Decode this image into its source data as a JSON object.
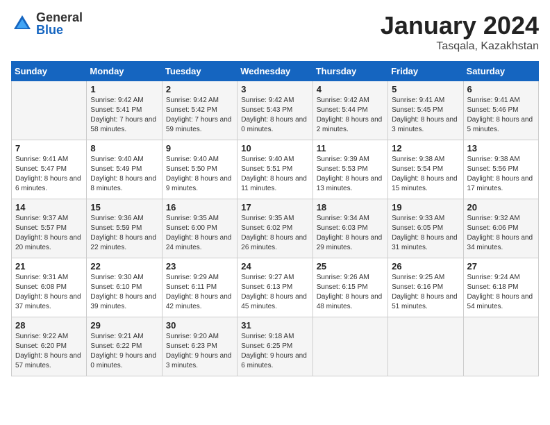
{
  "header": {
    "logo_general": "General",
    "logo_blue": "Blue",
    "title": "January 2024",
    "subtitle": "Tasqala, Kazakhstan"
  },
  "days_of_week": [
    "Sunday",
    "Monday",
    "Tuesday",
    "Wednesday",
    "Thursday",
    "Friday",
    "Saturday"
  ],
  "weeks": [
    [
      {
        "day": "",
        "info": ""
      },
      {
        "day": "1",
        "info": "Sunrise: 9:42 AM\nSunset: 5:41 PM\nDaylight: 7 hours\nand 58 minutes."
      },
      {
        "day": "2",
        "info": "Sunrise: 9:42 AM\nSunset: 5:42 PM\nDaylight: 7 hours\nand 59 minutes."
      },
      {
        "day": "3",
        "info": "Sunrise: 9:42 AM\nSunset: 5:43 PM\nDaylight: 8 hours\nand 0 minutes."
      },
      {
        "day": "4",
        "info": "Sunrise: 9:42 AM\nSunset: 5:44 PM\nDaylight: 8 hours\nand 2 minutes."
      },
      {
        "day": "5",
        "info": "Sunrise: 9:41 AM\nSunset: 5:45 PM\nDaylight: 8 hours\nand 3 minutes."
      },
      {
        "day": "6",
        "info": "Sunrise: 9:41 AM\nSunset: 5:46 PM\nDaylight: 8 hours\nand 5 minutes."
      }
    ],
    [
      {
        "day": "7",
        "info": "Sunrise: 9:41 AM\nSunset: 5:47 PM\nDaylight: 8 hours\nand 6 minutes."
      },
      {
        "day": "8",
        "info": "Sunrise: 9:40 AM\nSunset: 5:49 PM\nDaylight: 8 hours\nand 8 minutes."
      },
      {
        "day": "9",
        "info": "Sunrise: 9:40 AM\nSunset: 5:50 PM\nDaylight: 8 hours\nand 9 minutes."
      },
      {
        "day": "10",
        "info": "Sunrise: 9:40 AM\nSunset: 5:51 PM\nDaylight: 8 hours\nand 11 minutes."
      },
      {
        "day": "11",
        "info": "Sunrise: 9:39 AM\nSunset: 5:53 PM\nDaylight: 8 hours\nand 13 minutes."
      },
      {
        "day": "12",
        "info": "Sunrise: 9:38 AM\nSunset: 5:54 PM\nDaylight: 8 hours\nand 15 minutes."
      },
      {
        "day": "13",
        "info": "Sunrise: 9:38 AM\nSunset: 5:56 PM\nDaylight: 8 hours\nand 17 minutes."
      }
    ],
    [
      {
        "day": "14",
        "info": "Sunrise: 9:37 AM\nSunset: 5:57 PM\nDaylight: 8 hours\nand 20 minutes."
      },
      {
        "day": "15",
        "info": "Sunrise: 9:36 AM\nSunset: 5:59 PM\nDaylight: 8 hours\nand 22 minutes."
      },
      {
        "day": "16",
        "info": "Sunrise: 9:35 AM\nSunset: 6:00 PM\nDaylight: 8 hours\nand 24 minutes."
      },
      {
        "day": "17",
        "info": "Sunrise: 9:35 AM\nSunset: 6:02 PM\nDaylight: 8 hours\nand 26 minutes."
      },
      {
        "day": "18",
        "info": "Sunrise: 9:34 AM\nSunset: 6:03 PM\nDaylight: 8 hours\nand 29 minutes."
      },
      {
        "day": "19",
        "info": "Sunrise: 9:33 AM\nSunset: 6:05 PM\nDaylight: 8 hours\nand 31 minutes."
      },
      {
        "day": "20",
        "info": "Sunrise: 9:32 AM\nSunset: 6:06 PM\nDaylight: 8 hours\nand 34 minutes."
      }
    ],
    [
      {
        "day": "21",
        "info": "Sunrise: 9:31 AM\nSunset: 6:08 PM\nDaylight: 8 hours\nand 37 minutes."
      },
      {
        "day": "22",
        "info": "Sunrise: 9:30 AM\nSunset: 6:10 PM\nDaylight: 8 hours\nand 39 minutes."
      },
      {
        "day": "23",
        "info": "Sunrise: 9:29 AM\nSunset: 6:11 PM\nDaylight: 8 hours\nand 42 minutes."
      },
      {
        "day": "24",
        "info": "Sunrise: 9:27 AM\nSunset: 6:13 PM\nDaylight: 8 hours\nand 45 minutes."
      },
      {
        "day": "25",
        "info": "Sunrise: 9:26 AM\nSunset: 6:15 PM\nDaylight: 8 hours\nand 48 minutes."
      },
      {
        "day": "26",
        "info": "Sunrise: 9:25 AM\nSunset: 6:16 PM\nDaylight: 8 hours\nand 51 minutes."
      },
      {
        "day": "27",
        "info": "Sunrise: 9:24 AM\nSunset: 6:18 PM\nDaylight: 8 hours\nand 54 minutes."
      }
    ],
    [
      {
        "day": "28",
        "info": "Sunrise: 9:22 AM\nSunset: 6:20 PM\nDaylight: 8 hours\nand 57 minutes."
      },
      {
        "day": "29",
        "info": "Sunrise: 9:21 AM\nSunset: 6:22 PM\nDaylight: 9 hours\nand 0 minutes."
      },
      {
        "day": "30",
        "info": "Sunrise: 9:20 AM\nSunset: 6:23 PM\nDaylight: 9 hours\nand 3 minutes."
      },
      {
        "day": "31",
        "info": "Sunrise: 9:18 AM\nSunset: 6:25 PM\nDaylight: 9 hours\nand 6 minutes."
      },
      {
        "day": "",
        "info": ""
      },
      {
        "day": "",
        "info": ""
      },
      {
        "day": "",
        "info": ""
      }
    ]
  ]
}
